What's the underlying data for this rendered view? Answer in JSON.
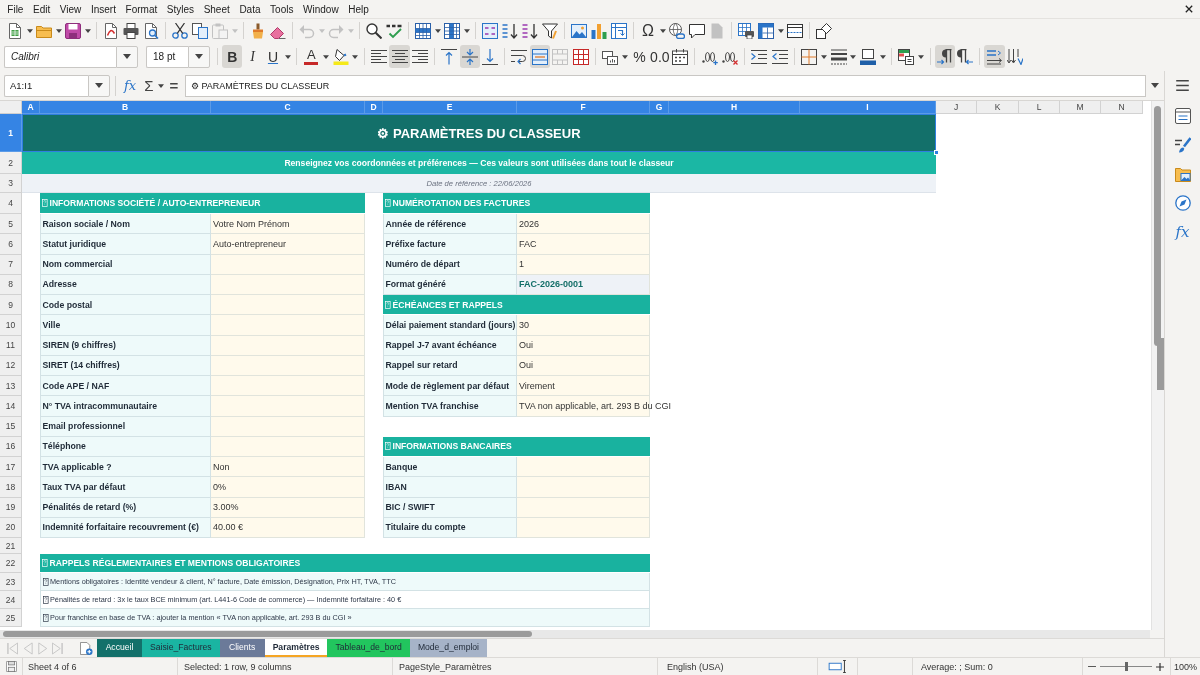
{
  "menu_bar": {
    "items": [
      "File",
      "Edit",
      "View",
      "Insert",
      "Format",
      "Styles",
      "Sheet",
      "Data",
      "Tools",
      "Window",
      "Help"
    ]
  },
  "standard_toolbar": {
    "paste_disabled": true,
    "undo_disabled": true,
    "redo_disabled": true,
    "header_footer_disabled": true,
    "special_character": "Ω"
  },
  "format_toolbar": {
    "font_name": "Calibri",
    "font_size": "18 pt",
    "bold": {
      "label": "B",
      "on": true
    },
    "italic": {
      "label": "I",
      "on": false
    },
    "underline": {
      "label": "U",
      "on": false
    },
    "font_color": "A",
    "align_center_on": true,
    "align_middle_on": true,
    "merge_center_on": true,
    "merge_disabled": true,
    "percent": "%",
    "standard_format": "0.0",
    "left_to_right_on": true,
    "text_direction_on": true
  },
  "formula_bar": {
    "name_box": "A1:I1",
    "function_wizard": "fx",
    "sum": "Σ",
    "equals": "=",
    "content": "⚙ PARAMÈTRES DU CLASSEUR"
  },
  "sheet": {
    "columns": [
      {
        "label": "A",
        "selected": true
      },
      {
        "label": "B",
        "selected": true
      },
      {
        "label": "C",
        "selected": true
      },
      {
        "label": "D",
        "selected": true
      },
      {
        "label": "E",
        "selected": true
      },
      {
        "label": "F",
        "selected": true
      },
      {
        "label": "G",
        "selected": true
      },
      {
        "label": "H",
        "selected": true
      },
      {
        "label": "I",
        "selected": true
      },
      {
        "label": "J",
        "selected": false
      },
      {
        "label": "K",
        "selected": false
      },
      {
        "label": "L",
        "selected": false
      },
      {
        "label": "M",
        "selected": false
      },
      {
        "label": "N",
        "selected": false
      }
    ],
    "rows": [
      {
        "label": "1",
        "selected": true
      },
      {
        "label": "2",
        "selected": false
      },
      {
        "label": "3",
        "selected": false
      },
      {
        "label": "4",
        "selected": false
      },
      {
        "label": "5",
        "selected": false
      },
      {
        "label": "6",
        "selected": false
      },
      {
        "label": "7",
        "selected": false
      },
      {
        "label": "8",
        "selected": false
      },
      {
        "label": "9",
        "selected": false
      },
      {
        "label": "10",
        "selected": false
      },
      {
        "label": "11",
        "selected": false
      },
      {
        "label": "12",
        "selected": false
      },
      {
        "label": "13",
        "selected": false
      },
      {
        "label": "14",
        "selected": false
      },
      {
        "label": "15",
        "selected": false
      },
      {
        "label": "16",
        "selected": false
      },
      {
        "label": "17",
        "selected": false
      },
      {
        "label": "18",
        "selected": false
      },
      {
        "label": "19",
        "selected": false
      },
      {
        "label": "20",
        "selected": false
      },
      {
        "label": "21",
        "selected": false
      },
      {
        "label": "22",
        "selected": false
      },
      {
        "label": "23",
        "selected": false
      },
      {
        "label": "24",
        "selected": false
      },
      {
        "label": "25",
        "selected": false
      }
    ],
    "title": {
      "text": "⚙ PARAMÈTRES DU CLASSEUR",
      "selected": true
    },
    "subtitle": "Renseignez vos coordonnées et préférences — Ces valeurs sont utilisées dans tout le classeur",
    "date_note": "Date de référence : 22/06/2026",
    "left_sections": [
      {
        "heading": "INFORMATIONS SOCIÉTÉ / AUTO-ENTREPRENEUR",
        "fields": [
          {
            "label": "Raison sociale / Nom",
            "value": "Votre Nom Prénom"
          },
          {
            "label": "Statut juridique",
            "value": "Auto-entrepreneur"
          },
          {
            "label": "Nom commercial"
          },
          {
            "label": "Adresse"
          },
          {
            "label": "Code postal"
          },
          {
            "label": "Ville"
          },
          {
            "label": "SIREN (9 chiffres)"
          },
          {
            "label": "SIRET (14 chiffres)"
          },
          {
            "label": "Code APE / NAF"
          },
          {
            "label": "N° TVA intracommunautaire"
          },
          {
            "label": "Email professionnel"
          },
          {
            "label": "Téléphone"
          },
          {
            "label": "TVA applicable ?",
            "value": "Non"
          },
          {
            "label": "Taux TVA par défaut",
            "value": "0%"
          },
          {
            "label": "Pénalités de retard (%)",
            "value": "3.00%"
          },
          {
            "label": "Indemnité forfaitaire recouvrement (€)",
            "value": "40.00 €"
          }
        ]
      }
    ],
    "right_sections": [
      {
        "heading": "NUMÉROTATION DES FACTURES",
        "fields": [
          {
            "label": "Année de référence",
            "value": "2026",
            "kind": "input"
          },
          {
            "label": "Préfixe facture",
            "value": "FAC",
            "kind": "input"
          },
          {
            "label": "Numéro de départ",
            "value": "1",
            "kind": "input"
          },
          {
            "label": "Format généré",
            "value": "FAC-2026-0001",
            "kind": "computed"
          }
        ]
      },
      {
        "heading": "ÉCHÉANCES ET RAPPELS",
        "fields": [
          {
            "label": "Délai paiement standard (jours)",
            "value": "30"
          },
          {
            "label": "Rappel J-7 avant échéance",
            "value": "Oui"
          },
          {
            "label": "Rappel sur retard",
            "value": "Oui"
          },
          {
            "label": "Mode de règlement par défaut",
            "value": "Virement"
          },
          {
            "label": "Mention TVA franchise",
            "value": "TVA non applicable, art. 293 B du CGI"
          }
        ]
      },
      {
        "heading": "INFORMATIONS BANCAIRES",
        "fields": [
          {
            "label": "Banque"
          },
          {
            "label": "IBAN"
          },
          {
            "label": "BIC / SWIFT"
          },
          {
            "label": "Titulaire du compte"
          }
        ]
      }
    ],
    "notes": {
      "heading": "RAPPELS RÉGLEMENTAIRES ET MENTIONS OBLIGATOIRES",
      "items": [
        "Mentions obligatoires : Identité vendeur & client, N° facture, Date émission, Désignation, Prix HT, TVA, TTC",
        "Pénalités de retard : 3x le taux BCE minimum (art. L441-6 Code de commerce) — Indemnité forfaitaire : 40 €",
        "Pour franchise en base de TVA : ajouter la mention « TVA non applicable, art. 293 B du CGI »"
      ]
    }
  },
  "sheet_tab_bar": {
    "navigation_disabled": true,
    "tabs": [
      {
        "label": "Accueil",
        "color": "#13706a",
        "selected": false
      },
      {
        "label": "Saisie_Factures",
        "color": "#1ab5a2",
        "selected": false
      },
      {
        "label": "Clients",
        "color": "#6b7a99",
        "selected": false
      },
      {
        "label": "Paramètres",
        "color": "#f5a524",
        "selected": true
      },
      {
        "label": "Tableau_de_bord",
        "color": "#22c55e",
        "selected": false
      },
      {
        "label": "Mode_d_emploi",
        "color": "#a6b3c8",
        "selected": false
      }
    ]
  },
  "status_bar": {
    "sheet": "Sheet 4 of 6",
    "selection": "Selected: 1 row, 9 columns",
    "page_style": "PageStyle_Paramètres",
    "language": "English (USA)",
    "summary": "Average: ; Sum: 0",
    "zoom": {
      "level": 0.5,
      "reading": "100%"
    }
  },
  "sidebar": {
    "functions": "fx"
  }
}
